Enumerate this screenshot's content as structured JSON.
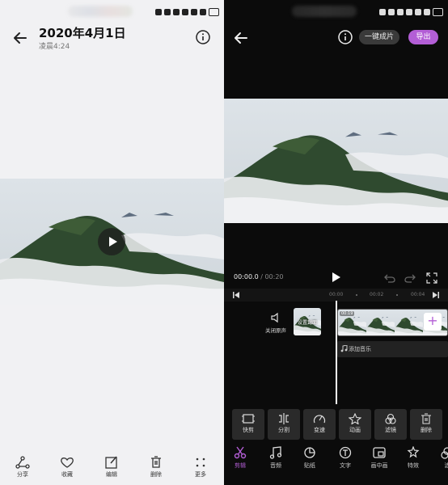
{
  "left": {
    "title": "2020年4月1日",
    "subtitle": "凌晨4:24",
    "bottom_actions": [
      {
        "label": "分享",
        "icon": "share-icon"
      },
      {
        "label": "收藏",
        "icon": "heart-icon"
      },
      {
        "label": "编辑",
        "icon": "edit-icon"
      },
      {
        "label": "删除",
        "icon": "trash-icon"
      },
      {
        "label": "更多",
        "icon": "more-icon"
      }
    ]
  },
  "right": {
    "one_key_label": "一键成片",
    "export_label": "导出",
    "time_current": "00:00.0",
    "time_total": " / 00:20",
    "ticks": [
      "00:00",
      "00:02",
      "00:04"
    ],
    "mute_label": "关闭原声",
    "cover_label": "设置封面",
    "clip_tag": "00:19",
    "music_label": "添加音乐",
    "tools": [
      {
        "label": "快剪",
        "icon": "quick-cut-icon"
      },
      {
        "label": "分割",
        "icon": "split-icon"
      },
      {
        "label": "变速",
        "icon": "speed-icon"
      },
      {
        "label": "动画",
        "icon": "animation-icon"
      },
      {
        "label": "滤镜",
        "icon": "filter-icon"
      },
      {
        "label": "删除",
        "icon": "trash-icon"
      }
    ],
    "nav": [
      {
        "label": "剪辑",
        "icon": "scissors-icon",
        "active": true
      },
      {
        "label": "音频",
        "icon": "music-note-icon"
      },
      {
        "label": "贴纸",
        "icon": "sticker-icon"
      },
      {
        "label": "文字",
        "icon": "text-icon"
      },
      {
        "label": "画中画",
        "icon": "pip-icon"
      },
      {
        "label": "特效",
        "icon": "effects-icon"
      },
      {
        "label": "滤",
        "icon": "filter-icon"
      }
    ],
    "accent_color": "#b35ed6"
  }
}
